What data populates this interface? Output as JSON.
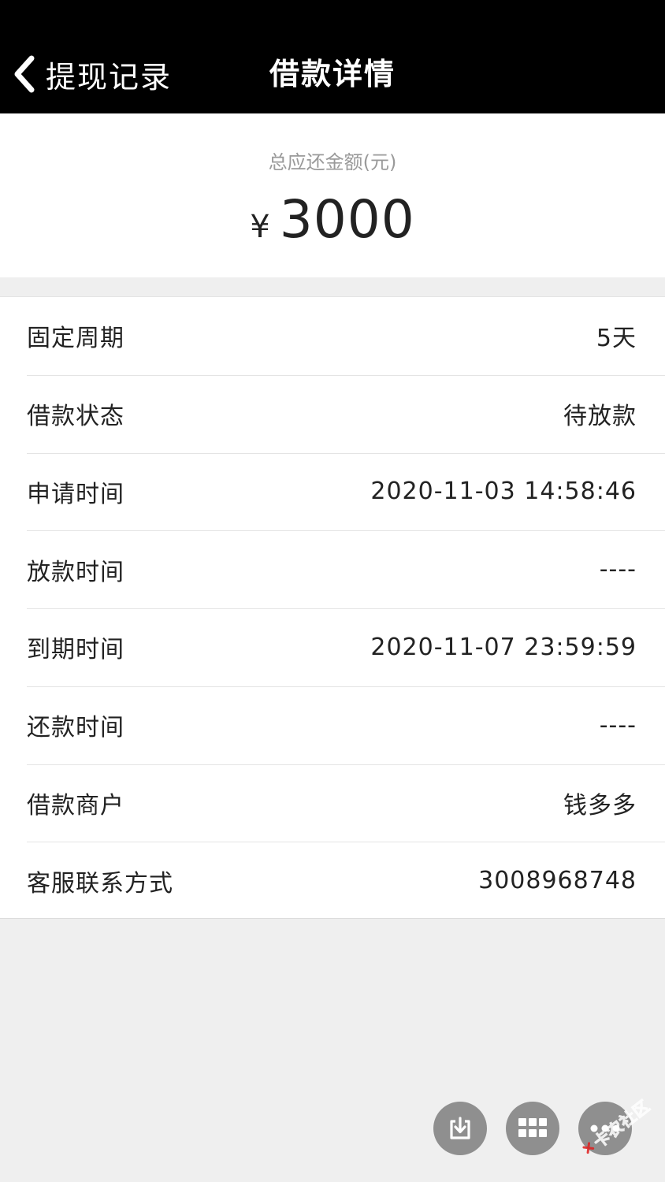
{
  "header": {
    "back_label": "提现记录",
    "title": "借款详情"
  },
  "amount": {
    "label": "总应还金额(元)",
    "currency_symbol": "¥",
    "value": "3000"
  },
  "details": [
    {
      "label": "固定周期",
      "value": "5天"
    },
    {
      "label": "借款状态",
      "value": "待放款"
    },
    {
      "label": "申请时间",
      "value": "2020-11-03 14:58:46"
    },
    {
      "label": "放款时间",
      "value": "----"
    },
    {
      "label": "到期时间",
      "value": "2020-11-07 23:59:59"
    },
    {
      "label": "还款时间",
      "value": "----"
    },
    {
      "label": "借款商户",
      "value": "钱多多"
    },
    {
      "label": "客服联系方式",
      "value": "3008968748"
    }
  ],
  "floating_buttons": [
    {
      "icon": "download-icon"
    },
    {
      "icon": "grid-icon"
    },
    {
      "icon": "more-icon"
    }
  ],
  "watermark": {
    "text": "卡农社区"
  },
  "colors": {
    "header_bg": "#000000",
    "page_bg": "#efefef",
    "fab_bg": "#8f8f8f",
    "watermark": "#e02020"
  }
}
